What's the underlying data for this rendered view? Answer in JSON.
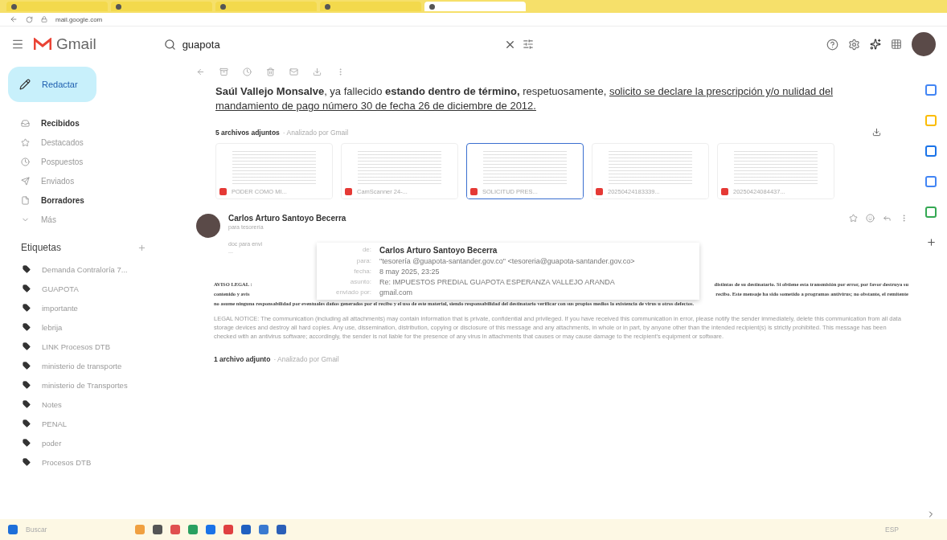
{
  "browser": {
    "tabs": [
      {
        "selected": false
      },
      {
        "selected": false
      },
      {
        "selected": false
      },
      {
        "selected": false
      },
      {
        "selected": true
      }
    ],
    "address": "mail.google.com"
  },
  "header": {
    "logo": "Gmail",
    "search": "guapota"
  },
  "sidebar": {
    "compose": "Redactar",
    "items": [
      {
        "label": "Recibidos",
        "bold": true
      },
      {
        "label": "Destacados",
        "bold": false
      },
      {
        "label": "Pospuestos",
        "bold": false
      },
      {
        "label": "Enviados",
        "bold": false
      },
      {
        "label": "Borradores",
        "bold": true
      },
      {
        "label": "Más",
        "bold": false
      }
    ],
    "labels_title": "Etiquetas",
    "labels": [
      "Demanda Contraloría 7...",
      "GUAPOTA",
      "importante",
      "lebrija",
      "LINK Procesos DTB",
      "ministerio de transporte",
      "ministerio de Transportes",
      "Notes",
      "PENAL",
      "poder",
      "Procesos DTB"
    ]
  },
  "message": {
    "body": [
      {
        "kind": "bold",
        "text": "Saúl Vallejo Monsalve"
      },
      {
        "kind": "plain",
        "text": ", ya fallecido "
      },
      {
        "kind": "bold",
        "text": "estando dentro de término,"
      },
      {
        "kind": "plain",
        "text": " respetuosamente, "
      },
      {
        "kind": "underline",
        "text": "solicito se declare la prescripción y/o nulidad del mandamiento de pago número 30 de fecha 26 de diciembre de 2012."
      }
    ],
    "attachments_title": "5 archivos adjuntos",
    "scanned": "· Analizado por Gmail",
    "attachments": [
      {
        "name": "PODER COMO MI...",
        "selected": false
      },
      {
        "name": "CamScanner 24-...",
        "selected": false
      },
      {
        "name": "SOLICITUD PRES...",
        "selected": true
      },
      {
        "name": "20250424183339...",
        "selected": false
      },
      {
        "name": "20250424084437...",
        "selected": false
      }
    ]
  },
  "reply": {
    "sender": "Carlos Arturo Santoyo Becerra",
    "recipient": "para tesorería",
    "snippet": "doc para envi",
    "ellipsis": "...",
    "details": [
      {
        "label": "de:",
        "value": "Carlos Arturo Santoyo Becerra",
        "bold": true
      },
      {
        "label": "para:",
        "value": "\"tesorería @guapota-santander.gov.co\" <tesoreria@guapota-santander.gov.co>",
        "bold": false
      },
      {
        "label": "fecha:",
        "value": "8 may 2025, 23:25",
        "bold": false
      },
      {
        "label": "asunto:",
        "value": "Re: IMPUESTOS PREDIAL GUAPOTA ESPERANZA VALLEJO ARANDA",
        "bold": false
      },
      {
        "label": "enviado por:",
        "value": "gmail.com",
        "bold": false
      }
    ],
    "legal_rows": [
      {
        "left": "AVISO LEGAL :",
        "right": "distintas de su destinatario. Si obtiene esta transmisión por error, por favor destruya su"
      },
      {
        "left": "contenido y avis",
        "right": "recibo. Este mensaje ha sido sometido a programas antivirus; no obstante, el remitente"
      }
    ],
    "legal_full": "no asume ninguna responsabilidad por eventuales daños generados por el recibo y el uso de este material, siendo responsabilidad del destinatario verificar con sus propios medios la existencia de virus u otros defectos.",
    "legal_notice": "LEGAL NOTICE: The communication (including all attachments) may contain information that is private, confidential and privileged. If you have received this communication in error, please notify the sender immediately, delete this communication from all data storage devices and destroy all hard copies. Any use, dissemination, distribution, copying or disclosure of this message and any attachments, in whole or in part, by anyone other than the intended recipient(s) is strictly prohibited. This message has been checked with an antivirus software; accordingly, the sender is not liable for the presence of any virus in attachments that causes or may cause damage to the recipient's equipment or software.",
    "attachments_title": "1 archivo adjunto",
    "scanned": "· Analizado por Gmail"
  },
  "taskbar": {
    "search": "Buscar",
    "language": "ESP"
  }
}
